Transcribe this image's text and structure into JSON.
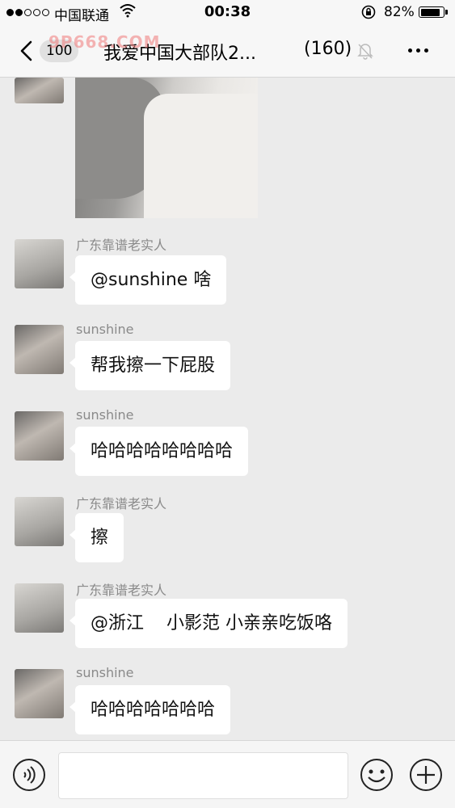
{
  "status_bar": {
    "carrier": "中国联通",
    "time": "00:38",
    "battery_percent": "82%",
    "battery_level": 0.82,
    "signal_strength": 2
  },
  "nav": {
    "back_badge": "100",
    "title": "我爱中国大部队2...",
    "member_count": "(160)"
  },
  "watermark": "9P668.COM",
  "messages": [
    {
      "sender": "",
      "type": "image"
    },
    {
      "sender": "广东靠谱老实人",
      "text": "@sunshine 啥"
    },
    {
      "sender": "sunshine",
      "text": "帮我擦一下屁股"
    },
    {
      "sender": "sunshine",
      "text": "哈哈哈哈哈哈哈哈"
    },
    {
      "sender": "广东靠谱老实人",
      "text": "擦"
    },
    {
      "sender": "广东靠谱老实人",
      "text": "@浙江    小影范 小亲亲吃饭咯"
    },
    {
      "sender": "sunshine",
      "text": "哈哈哈哈哈哈哈"
    }
  ],
  "input_bar": {
    "placeholder": ""
  },
  "colors": {
    "background": "#ebebeb",
    "bar": "#f7f7f7",
    "bubble": "#ffffff"
  }
}
